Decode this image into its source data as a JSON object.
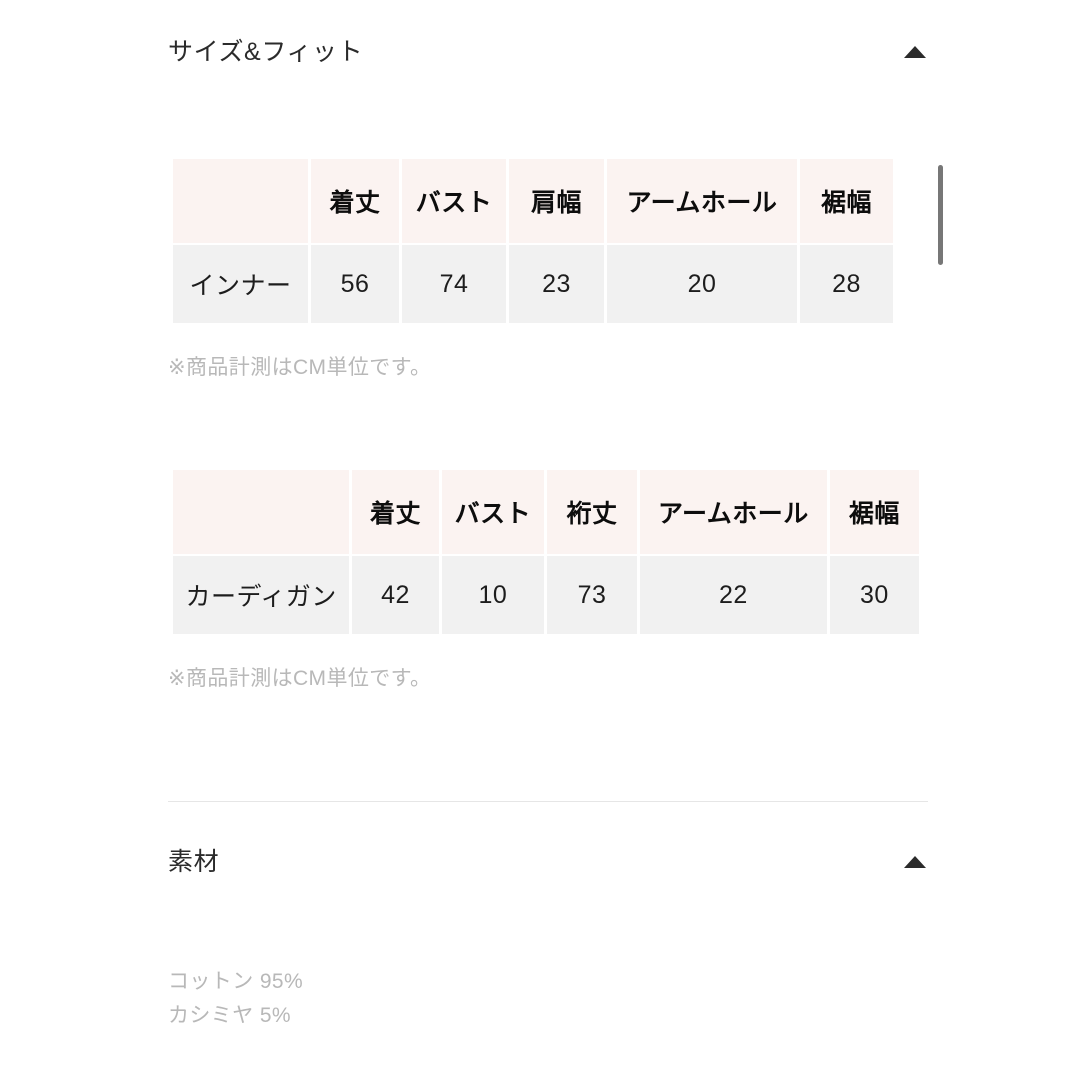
{
  "sections": [
    {
      "id": "size-and-fit",
      "title": "サイズ&フィット",
      "toggle_icon": "triangle-up-icon",
      "expanded": true
    },
    {
      "id": "material",
      "title": "素材",
      "toggle_icon": "triangle-up-icon",
      "expanded": true
    }
  ],
  "size_tables": [
    {
      "corner_label": "",
      "headers": [
        "着丈",
        "バスト",
        "肩幅",
        "アームホール",
        "裾幅"
      ],
      "rows": [
        {
          "label": "インナー",
          "values": [
            "56",
            "74",
            "23",
            "20",
            "28"
          ]
        }
      ],
      "note": "※商品計測はCM単位です。"
    },
    {
      "corner_label": "",
      "headers": [
        "着丈",
        "バスト",
        "裄丈",
        "アームホール",
        "裾幅"
      ],
      "rows": [
        {
          "label": "カーディガン",
          "values": [
            "42",
            "10",
            "73",
            "22",
            "30"
          ]
        }
      ],
      "note": "※商品計測はCM単位です。"
    }
  ],
  "material": {
    "lines": [
      "コットン 95%",
      "カシミヤ 5%"
    ]
  },
  "colors": {
    "page_background": "#ffffff",
    "header_cell": "#fbf3f1",
    "body_cell": "#f1f1f1",
    "title_text": "#2b2b2b",
    "header_text": "#0d0d0d",
    "value_text": "#1d1d1d",
    "muted_text": "#b8b8b8",
    "divider": "#e6e6e6",
    "scrollbar": "#777777"
  }
}
